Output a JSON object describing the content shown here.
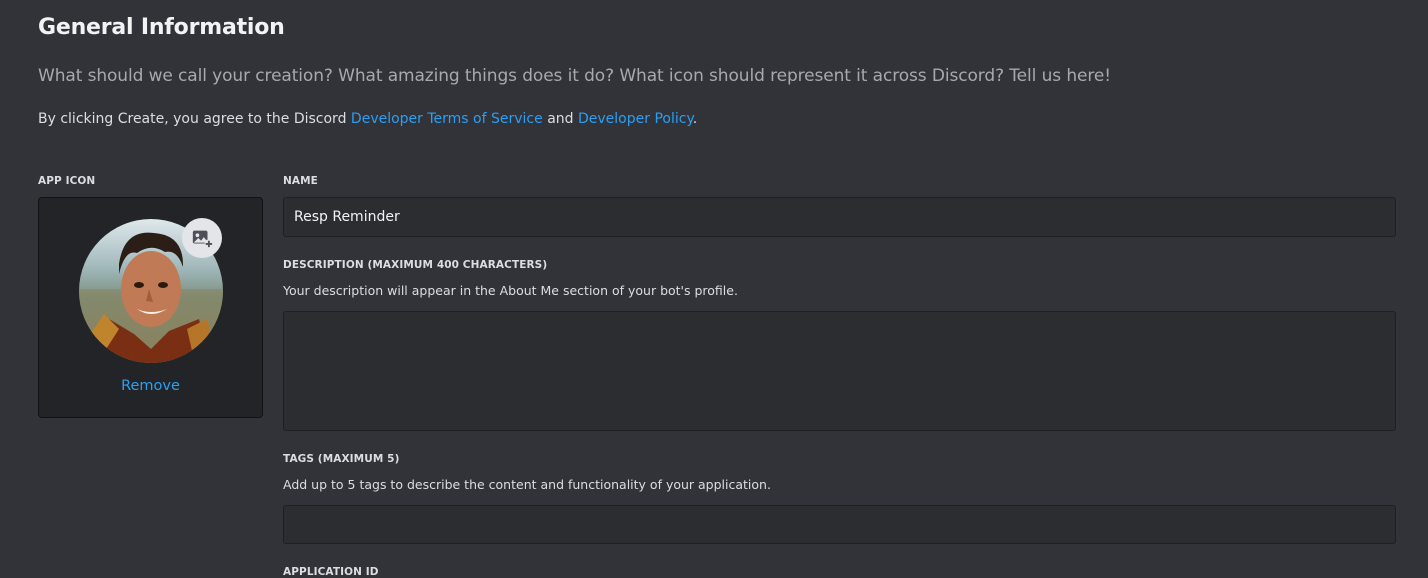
{
  "header": {
    "title": "General Information",
    "subtitle": "What should we call your creation? What amazing things does it do? What icon should represent it across Discord? Tell us here!",
    "agree_prefix": "By clicking Create, you agree to the Discord ",
    "terms_link": "Developer Terms of Service",
    "agree_middle": " and ",
    "policy_link": "Developer Policy",
    "agree_suffix": "."
  },
  "app_icon": {
    "label": "APP ICON",
    "upload_icon": "add-image-icon",
    "remove_label": "Remove"
  },
  "name_field": {
    "label": "NAME",
    "value": "Resp Reminder"
  },
  "description_field": {
    "label": "DESCRIPTION (MAXIMUM 400 CHARACTERS)",
    "help": "Your description will appear in the About Me section of your bot's profile.",
    "value": ""
  },
  "tags_field": {
    "label": "TAGS (MAXIMUM 5)",
    "help": "Add up to 5 tags to describe the content and functionality of your application.",
    "value": ""
  },
  "application_id": {
    "label": "APPLICATION ID"
  },
  "colors": {
    "background": "#313338",
    "link": "#2b9ff2",
    "input_bg": "#2b2d31"
  }
}
